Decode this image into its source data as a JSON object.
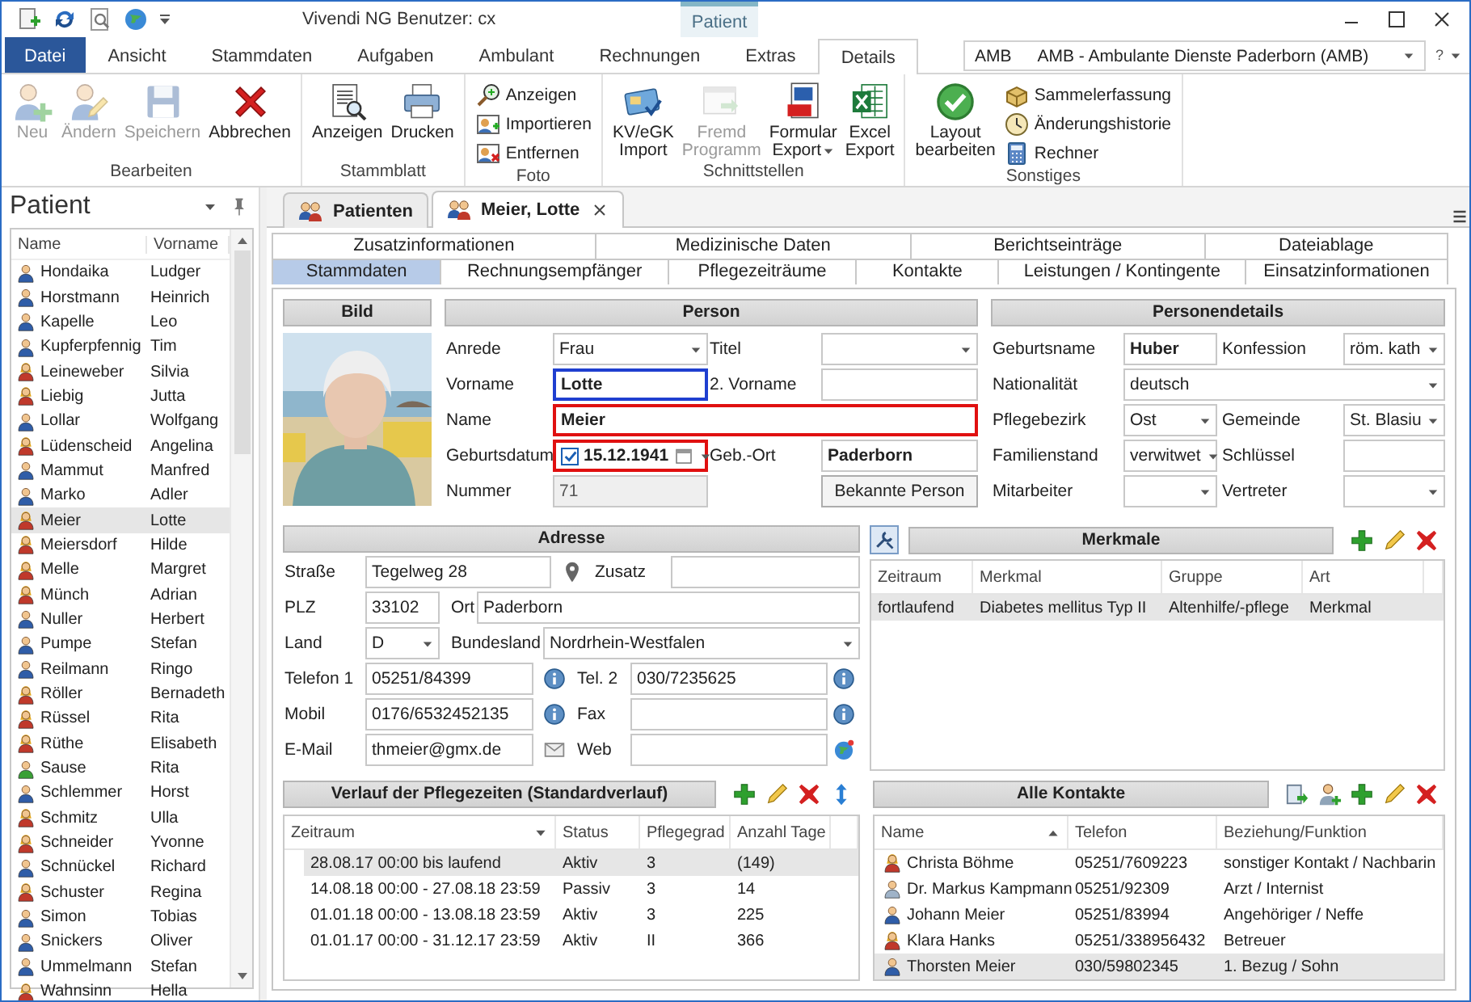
{
  "window": {
    "title": "Vivendi NG Benutzer: cx",
    "context_tab": "Patient"
  },
  "ribbon": {
    "tabs": [
      {
        "label": "Datei",
        "kind": "file",
        "selected": false
      },
      {
        "label": "Ansicht",
        "kind": "tab",
        "selected": false
      },
      {
        "label": "Stammdaten",
        "kind": "tab",
        "selected": false
      },
      {
        "label": "Aufgaben",
        "kind": "tab",
        "selected": false
      },
      {
        "label": "Ambulant",
        "kind": "tab",
        "selected": false
      },
      {
        "label": "Rechnungen",
        "kind": "tab",
        "selected": false
      },
      {
        "label": "Extras",
        "kind": "tab",
        "selected": false
      },
      {
        "label": "Details",
        "kind": "tab",
        "selected": true
      }
    ],
    "company": {
      "code": "AMB",
      "name": "AMB - Ambulante Dienste Paderborn (AMB)"
    },
    "help": "?",
    "groups": [
      {
        "label": "Bearbeiten",
        "buttons": [
          {
            "label": "Neu",
            "kind": "large",
            "disabled": true
          },
          {
            "label": "Ändern",
            "kind": "large",
            "disabled": true
          },
          {
            "label": "Speichern",
            "kind": "large",
            "disabled": true
          },
          {
            "label": "Abbrechen",
            "kind": "large",
            "disabled": false
          }
        ]
      },
      {
        "label": "Stammblatt",
        "buttons": [
          {
            "label": "Anzeigen",
            "kind": "large",
            "disabled": false
          },
          {
            "label": "Drucken",
            "kind": "large",
            "disabled": false
          }
        ]
      },
      {
        "label": "Foto",
        "buttons": [
          {
            "label": "Anzeigen",
            "kind": "small",
            "disabled": false
          },
          {
            "label": "Importieren",
            "kind": "small",
            "disabled": false
          },
          {
            "label": "Entfernen",
            "kind": "small",
            "disabled": false
          }
        ]
      },
      {
        "label": "Schnittstellen",
        "buttons": [
          {
            "label": "KV/eGK Import",
            "kind": "large",
            "disabled": false
          },
          {
            "label": "Fremd Programm",
            "kind": "large",
            "disabled": true
          },
          {
            "label": "Formular Export",
            "kind": "large",
            "disabled": false,
            "menu": true
          },
          {
            "label": "Excel Export",
            "kind": "large",
            "disabled": false
          }
        ]
      },
      {
        "label": "Sonstiges",
        "buttons": [
          {
            "label": "Layout bearbeiten",
            "kind": "large",
            "disabled": false
          },
          {
            "label": "Sammelerfassung",
            "kind": "small",
            "disabled": false
          },
          {
            "label": "Änderungshistorie",
            "kind": "small",
            "disabled": false
          },
          {
            "label": "Rechner",
            "kind": "small",
            "disabled": false
          }
        ]
      }
    ]
  },
  "sidebar": {
    "title": "Patient",
    "columns": [
      "Name",
      "Vorname"
    ],
    "rows": [
      {
        "name": "Hondaika",
        "first": "Ludger",
        "kind": "male",
        "selected": false
      },
      {
        "name": "Horstmann",
        "first": "Heinrich",
        "kind": "male",
        "selected": false
      },
      {
        "name": "Kapelle",
        "first": "Leo",
        "kind": "male",
        "selected": false
      },
      {
        "name": "Kupferpfennig",
        "first": "Tim",
        "kind": "male",
        "selected": false
      },
      {
        "name": "Leineweber",
        "first": "Silvia",
        "kind": "female",
        "selected": false
      },
      {
        "name": "Liebig",
        "first": "Jutta",
        "kind": "female",
        "selected": false
      },
      {
        "name": "Lollar",
        "first": "Wolfgang",
        "kind": "male",
        "selected": false
      },
      {
        "name": "Lüdenscheid",
        "first": "Angelina",
        "kind": "female",
        "selected": false
      },
      {
        "name": "Mammut",
        "first": "Manfred",
        "kind": "male",
        "selected": false
      },
      {
        "name": "Marko",
        "first": "Adler",
        "kind": "male",
        "selected": false
      },
      {
        "name": "Meier",
        "first": "Lotte",
        "kind": "female",
        "selected": true
      },
      {
        "name": "Meiersdorf",
        "first": "Hilde",
        "kind": "female",
        "selected": false
      },
      {
        "name": "Melle",
        "first": "Margret",
        "kind": "female",
        "selected": false
      },
      {
        "name": "Münch",
        "first": "Adrian",
        "kind": "female",
        "selected": false
      },
      {
        "name": "Nuller",
        "first": "Herbert",
        "kind": "male",
        "selected": false
      },
      {
        "name": "Pumpe",
        "first": "Stefan",
        "kind": "male",
        "selected": false
      },
      {
        "name": "Reilmann",
        "first": "Ringo",
        "kind": "male",
        "selected": false
      },
      {
        "name": "Röller",
        "first": "Bernadeth",
        "kind": "female",
        "selected": false
      },
      {
        "name": "Rüssel",
        "first": "Rita",
        "kind": "female",
        "selected": false
      },
      {
        "name": "Rüthe",
        "first": "Elisabeth",
        "kind": "female",
        "selected": false
      },
      {
        "name": "Sause",
        "first": "Rita",
        "kind": "staff",
        "selected": false
      },
      {
        "name": "Schlemmer",
        "first": "Horst",
        "kind": "male",
        "selected": false
      },
      {
        "name": "Schmitz",
        "first": "Ulla",
        "kind": "female",
        "selected": false
      },
      {
        "name": "Schneider",
        "first": "Yvonne",
        "kind": "female",
        "selected": false
      },
      {
        "name": "Schnückel",
        "first": "Richard",
        "kind": "male",
        "selected": false
      },
      {
        "name": "Schuster",
        "first": "Regina",
        "kind": "female",
        "selected": false
      },
      {
        "name": "Simon",
        "first": "Tobias",
        "kind": "male",
        "selected": false
      },
      {
        "name": "Snickers",
        "first": "Oliver",
        "kind": "male",
        "selected": false
      },
      {
        "name": "Ummelmann",
        "first": "Stefan",
        "kind": "male",
        "selected": false
      },
      {
        "name": "Wahnsinn",
        "first": "Hella",
        "kind": "female",
        "selected": false
      }
    ]
  },
  "documents": {
    "tabs": [
      {
        "label": "Patienten",
        "selected": false
      },
      {
        "label": "Meier, Lotte",
        "selected": true
      }
    ]
  },
  "stammdaten": {
    "tabs": [
      [
        {
          "label": "Zusatzinformationen",
          "selected": false
        },
        {
          "label": "Medizinische Daten",
          "selected": false
        },
        {
          "label": "Berichtseinträge",
          "selected": false
        },
        {
          "label": "Dateiablage",
          "selected": false
        }
      ],
      [
        {
          "label": "Stammdaten",
          "selected": true
        },
        {
          "label": "Rechnungsempfänger",
          "selected": false
        },
        {
          "label": "Pflegezeiträume",
          "selected": false
        },
        {
          "label": "Kontakte",
          "selected": false
        },
        {
          "label": "Leistungen / Kontingente",
          "selected": false
        },
        {
          "label": "Einsatzinformationen",
          "selected": false
        }
      ]
    ],
    "photo_title": "Bild",
    "person": {
      "title": "Person",
      "rows": [
        [
          {
            "label": "Anrede",
            "value": "Frau",
            "kind": "combo",
            "focused": false,
            "invalid": false,
            "required": false
          },
          {
            "label": "Titel",
            "kind": "combo",
            "focused": false,
            "invalid": false
          }
        ],
        [
          {
            "label": "Vorname",
            "value": "Lotte",
            "kind": "text",
            "focused": true,
            "invalid": false,
            "required": true
          },
          {
            "label": "2. Vorname",
            "kind": "text",
            "focused": false,
            "invalid": false
          }
        ],
        [
          {
            "label": "Name",
            "value": "Meier",
            "kind": "text",
            "focused": false,
            "invalid": true,
            "required": true
          }
        ],
        [
          {
            "label": "Geburtsdatum",
            "value": "15.12.1941",
            "kind": "date",
            "checked": true,
            "focused": false,
            "invalid": true,
            "required": true
          },
          {
            "label": "Geb.-Ort",
            "value": "Paderborn",
            "kind": "text",
            "focused": false,
            "invalid": false,
            "required": true
          }
        ],
        [
          {
            "label": "Nummer",
            "value": "71",
            "kind": "readonly"
          },
          {
            "label": "Bekannte Person",
            "kind": "button"
          }
        ]
      ]
    },
    "details": {
      "title": "Personendetails",
      "rows": [
        [
          {
            "label": "Geburtsname",
            "value": "Huber",
            "kind": "text",
            "required": true
          },
          {
            "label": "Konfession",
            "value": "röm. kath",
            "kind": "combo",
            "required": false
          }
        ],
        [
          {
            "label": "Nationalität",
            "value": "deutsch",
            "kind": "combo",
            "required": false
          }
        ],
        [
          {
            "label": "Pflegebezirk",
            "value": "Ost",
            "kind": "combo",
            "required": false
          },
          {
            "label": "Gemeinde",
            "value": "St. Blasiu",
            "kind": "combo",
            "required": false
          }
        ],
        [
          {
            "label": "Familienstand",
            "value": "verwitwet",
            "kind": "combo",
            "required": false
          },
          {
            "label": "Schlüssel",
            "kind": "text"
          }
        ],
        [
          {
            "label": "Mitarbeiter",
            "kind": "combo"
          },
          {
            "label": "Vertreter",
            "kind": "combo"
          }
        ]
      ]
    },
    "address": {
      "title": "Adresse",
      "rows": [
        [
          {
            "label": "Straße",
            "value": "Tegelweg 28",
            "kind": "text"
          },
          {
            "label": "Zusatz",
            "kind": "text"
          }
        ],
        [
          {
            "label": "PLZ",
            "value": "33102",
            "kind": "text"
          },
          {
            "label": "Ort",
            "value": "Paderborn",
            "kind": "text"
          }
        ],
        [
          {
            "label": "Land",
            "value": "D",
            "kind": "combo"
          },
          {
            "label": "Bundesland",
            "value": "Nordrhein-Westfalen",
            "kind": "combo"
          }
        ],
        [
          {
            "label": "Telefon 1",
            "value": "05251/84399",
            "kind": "text"
          },
          {
            "label": "Tel. 2",
            "value": "030/7235625",
            "kind": "text"
          }
        ],
        [
          {
            "label": "Mobil",
            "value": "0176/6532452135",
            "kind": "text"
          },
          {
            "label": "Fax",
            "kind": "text"
          }
        ],
        [
          {
            "label": "E-Mail",
            "value": "thmeier@gmx.de",
            "kind": "text"
          },
          {
            "label": "Web",
            "kind": "text"
          }
        ]
      ]
    },
    "features": {
      "title": "Merkmale",
      "columns": [
        {
          "label": "Zeitraum"
        },
        {
          "label": "Merkmal"
        },
        {
          "label": "Gruppe"
        },
        {
          "label": "Art"
        }
      ],
      "rows": [
        {
          "cells": [
            "fortlaufend",
            "Diabetes mellitus Typ II",
            "Altenhilfe/-pflege",
            "Merkmal"
          ],
          "selected": true
        }
      ]
    },
    "care_history": {
      "title": "Verlauf der Pflegezeiten (Standardverlauf)",
      "columns": [
        {
          "label": "Zeitraum",
          "sorted": true,
          "ascending": false
        },
        {
          "label": "Status",
          "sorted": false
        },
        {
          "label": "Pflegegrad",
          "sorted": false
        },
        {
          "label": "Anzahl Tage",
          "sorted": false
        }
      ],
      "rows": [
        {
          "cells": [
            "28.08.17 00:00 bis laufend",
            "Aktiv",
            "3",
            "(149)"
          ],
          "selected": true
        },
        {
          "cells": [
            "14.08.18 00:00 - 27.08.18 23:59",
            "Passiv",
            "3",
            "14"
          ],
          "selected": false
        },
        {
          "cells": [
            "01.01.18 00:00 - 13.08.18 23:59",
            "Aktiv",
            "3",
            "225"
          ],
          "selected": false
        },
        {
          "cells": [
            "01.01.17 00:00 - 31.12.17 23:59",
            "Aktiv",
            "II",
            "366"
          ],
          "selected": false
        }
      ]
    },
    "contacts": {
      "title": "Alle Kontakte",
      "columns": [
        {
          "label": "Name",
          "sorted": true,
          "ascending": true
        },
        {
          "label": "Telefon",
          "sorted": false
        },
        {
          "label": "Beziehung/Funktion",
          "sorted": false
        }
      ],
      "rows": [
        {
          "kind": "female",
          "cells": [
            "Christa Böhme",
            "05251/7609223",
            "sonstiger Kontakt / Nachbarin"
          ],
          "selected": false
        },
        {
          "kind": "doctor",
          "cells": [
            "Dr. Markus Kampmann",
            "05251/92309",
            "Arzt / Internist"
          ],
          "selected": false
        },
        {
          "kind": "male",
          "cells": [
            "Johann Meier",
            "05251/83994",
            "Angehöriger / Neffe"
          ],
          "selected": false
        },
        {
          "kind": "female",
          "cells": [
            "Klara Hanks",
            "05251/338956432",
            "Betreuer"
          ],
          "selected": false
        },
        {
          "kind": "male",
          "cells": [
            "Thorsten Meier",
            "030/59802345",
            "1. Bezug / Sohn"
          ],
          "selected": true
        }
      ]
    }
  }
}
